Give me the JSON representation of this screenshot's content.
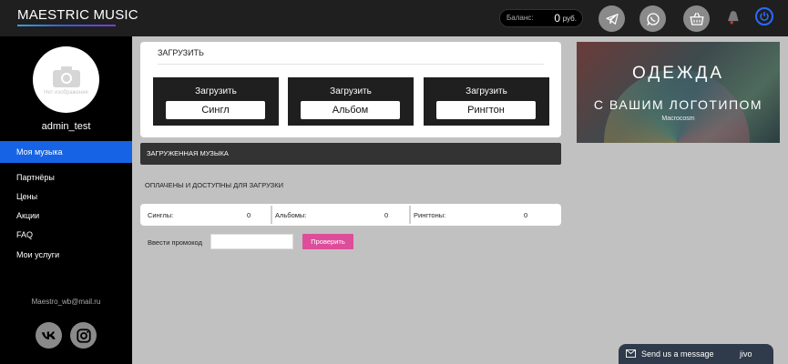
{
  "header": {
    "logo": "MAESTRIC MUSIC",
    "balance_label": "Баланс:",
    "balance_value": "0",
    "balance_currency": "руб.",
    "icons": [
      "telegram-icon",
      "whatsapp-icon",
      "cart-icon",
      "bell-icon",
      "power-icon"
    ],
    "accent": "#2a6bff"
  },
  "sidebar": {
    "avatar_caption": "Нет изображения",
    "username": "admin_test",
    "items": [
      {
        "label": "Моя музыка",
        "active": true
      },
      {
        "label": "Партнёры"
      },
      {
        "label": "Цены"
      },
      {
        "label": "Акции"
      },
      {
        "label": "FAQ"
      },
      {
        "label": "Мои услуги"
      }
    ],
    "email": "Maestro_wb@mail.ru",
    "active_color": "#1663e6"
  },
  "upload": {
    "title": "ЗАГРУЗИТЬ",
    "tiles": [
      {
        "label": "Загрузить",
        "button": "Сингл"
      },
      {
        "label": "Загрузить",
        "button": "Альбом"
      },
      {
        "label": "Загрузить",
        "button": "Рингтон"
      }
    ]
  },
  "uploaded": {
    "title": "ЗАГРУЖЕННАЯ МУЗЫКА",
    "paid_label": "ОПЛАЧЕНЫ И ДОСТУПНЫ ДЛЯ ЗАГРУЗКИ"
  },
  "stats": [
    {
      "label": "Синглы:",
      "value": "0"
    },
    {
      "label": "Альбомы:",
      "value": "0"
    },
    {
      "label": "Рингтоны:",
      "value": "0"
    }
  ],
  "promo": {
    "label": "Ввести промокод",
    "value": "",
    "button": "Проверить",
    "button_color": "#de4d9a"
  },
  "ad": {
    "line1": "ОДЕЖДА",
    "line2": "С ВАШИМ ЛОГОТИПОМ",
    "brand": "Macrocosm"
  },
  "chat": {
    "label": "Send us a message",
    "brand": "jivo"
  }
}
